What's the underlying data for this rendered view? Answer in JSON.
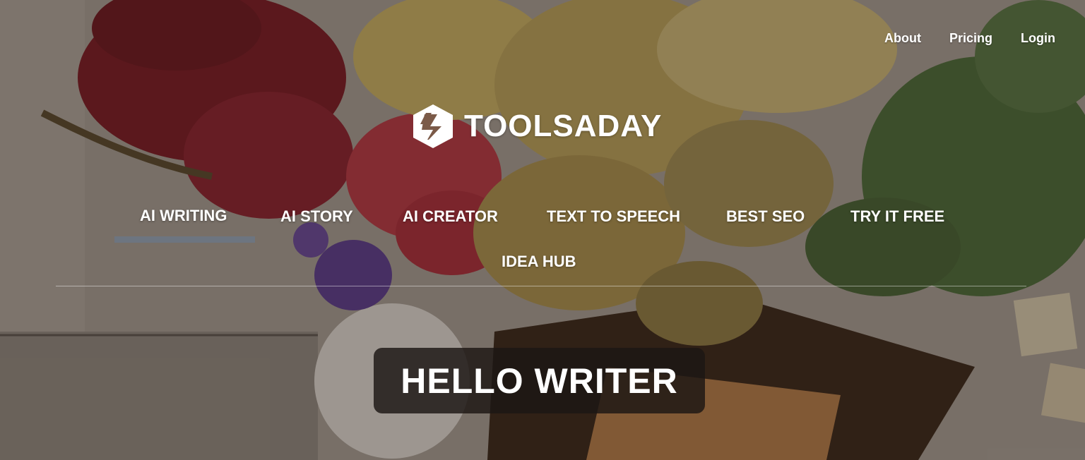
{
  "top_links": {
    "about": "About",
    "pricing": "Pricing",
    "login": "Login"
  },
  "logo": {
    "text": "TOOLSADAY"
  },
  "nav": {
    "items": [
      {
        "label": "AI WRITING",
        "active": true
      },
      {
        "label": "AI STORY"
      },
      {
        "label": "AI CREATOR"
      },
      {
        "label": "TEXT TO SPEECH"
      },
      {
        "label": "BEST SEO"
      },
      {
        "label": "TRY IT FREE"
      },
      {
        "label": "IDEA HUB"
      }
    ]
  },
  "hero": {
    "heading": "HELLO WRITER"
  },
  "colors": {
    "nav_active_underline": "#6d7580",
    "text": "#ffffff",
    "hello_box_bg": "#1c1614"
  }
}
